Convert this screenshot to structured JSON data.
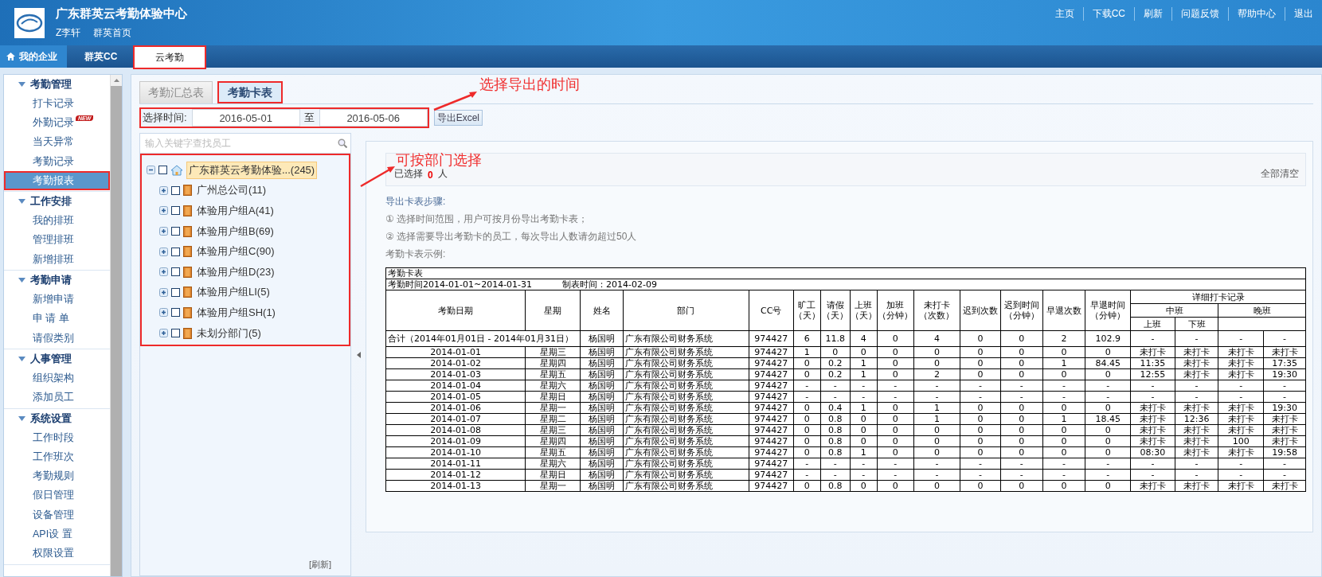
{
  "header": {
    "title": "广东群英云考勤体验中心",
    "user": "Z李轩",
    "home_link": "群英首页",
    "links": [
      "主页",
      "下载CC",
      "刷新",
      "问题反馈",
      "帮助中心",
      "退出"
    ]
  },
  "nav_tabs": [
    {
      "label": "我的企业",
      "kind": "home",
      "selected": false,
      "boxed": false
    },
    {
      "label": "群英CC",
      "kind": "tab",
      "selected": false,
      "boxed": false
    },
    {
      "label": "云考勤",
      "kind": "tab",
      "selected": true,
      "boxed": true
    }
  ],
  "sidebar": {
    "groups": [
      {
        "title": "考勤管理",
        "expanded": true,
        "items": [
          {
            "label": "打卡记录",
            "selected": false,
            "boxed": false
          },
          {
            "label": "外勤记录",
            "badge": "NEW",
            "selected": false,
            "boxed": false
          },
          {
            "label": "当天异常",
            "selected": false,
            "boxed": false
          },
          {
            "label": "考勤记录",
            "selected": false,
            "boxed": false
          },
          {
            "label": "考勤报表",
            "selected": true,
            "boxed": true
          }
        ]
      },
      {
        "title": "工作安排",
        "expanded": true,
        "items": [
          {
            "label": "我的排班",
            "selected": false,
            "boxed": false
          },
          {
            "label": "管理排班",
            "selected": false,
            "boxed": false
          },
          {
            "label": "新增排班",
            "selected": false,
            "boxed": false
          }
        ]
      },
      {
        "title": "考勤申请",
        "expanded": true,
        "items": [
          {
            "label": "新增申请",
            "selected": false,
            "boxed": false
          },
          {
            "label": "申 请 单",
            "selected": false,
            "boxed": false
          },
          {
            "label": "请假类别",
            "selected": false,
            "boxed": false
          }
        ]
      },
      {
        "title": "人事管理",
        "expanded": true,
        "items": [
          {
            "label": "组织架构",
            "selected": false,
            "boxed": false
          },
          {
            "label": "添加员工",
            "selected": false,
            "boxed": false
          }
        ]
      },
      {
        "title": "系统设置",
        "expanded": true,
        "items": [
          {
            "label": "工作时段",
            "selected": false,
            "boxed": false
          },
          {
            "label": "工作班次",
            "selected": false,
            "boxed": false
          },
          {
            "label": "考勤规则",
            "selected": false,
            "boxed": false
          },
          {
            "label": "假日管理",
            "selected": false,
            "boxed": false
          },
          {
            "label": "设备管理",
            "selected": false,
            "boxed": false
          },
          {
            "label": "API设 置",
            "selected": false,
            "boxed": false
          },
          {
            "label": "权限设置",
            "selected": false,
            "boxed": false
          }
        ]
      }
    ]
  },
  "report_tabs": [
    {
      "label": "考勤汇总表",
      "selected": false,
      "boxed": false
    },
    {
      "label": "考勤卡表",
      "selected": true,
      "boxed": true
    }
  ],
  "date_range": {
    "label": "选择时间:",
    "start": "2016-05-01",
    "separator": "至",
    "end": "2016-05-06",
    "boxed": true,
    "export_button": "导出Excel"
  },
  "tree": {
    "search_placeholder": "输入关键字查找员工",
    "boxed": true,
    "refresh": "[刷新]",
    "nodes": [
      {
        "label": "广东群英云考勤体验...(245)",
        "kind": "company",
        "expanded": true,
        "checked": false,
        "selected": true,
        "children": [
          {
            "label": "广州总公司(11)",
            "kind": "department",
            "expanded": false,
            "checked": false,
            "selected": false
          },
          {
            "label": "体验用户组A(41)",
            "kind": "department",
            "expanded": false,
            "checked": false,
            "selected": false
          },
          {
            "label": "体验用户组B(69)",
            "kind": "department",
            "expanded": false,
            "checked": false,
            "selected": false
          },
          {
            "label": "体验用户组C(90)",
            "kind": "department",
            "expanded": false,
            "checked": false,
            "selected": false
          },
          {
            "label": "体验用户组D(23)",
            "kind": "department",
            "expanded": false,
            "checked": false,
            "selected": false
          },
          {
            "label": "体验用户组LI(5)",
            "kind": "department",
            "expanded": false,
            "checked": false,
            "selected": false
          },
          {
            "label": "体验用户组SH(1)",
            "kind": "department",
            "expanded": false,
            "checked": false,
            "selected": false
          },
          {
            "label": "未划分部门(5)",
            "kind": "department",
            "expanded": false,
            "checked": false,
            "selected": false
          }
        ]
      }
    ]
  },
  "selection": {
    "label": "已选择",
    "count": "0",
    "unit": "人",
    "clear": "全部清空"
  },
  "steps": {
    "title": "导出卡表步骤:",
    "items": [
      "① 选择时间范围，用户可按月份导出考勤卡表；",
      "② 选择需要导出考勤卡的员工，每次导出人数请勿超过50人"
    ],
    "example_label": "考勤卡表示例:"
  },
  "card_table": {
    "title": "考勤卡表",
    "period": "考勤时间2014-01-01~2014-01-31",
    "made": "制表时间：2014-02-09",
    "columns": [
      {
        "title": "考勤日期"
      },
      {
        "title": "星期"
      },
      {
        "title": "姓名"
      },
      {
        "title": "部门"
      },
      {
        "title": "CC号"
      },
      {
        "title": "旷工",
        "unit": "（天）"
      },
      {
        "title": "请假",
        "unit": "（天）"
      },
      {
        "title": "上班",
        "unit": "（天）"
      },
      {
        "title": "加班",
        "unit": "（分钟）"
      },
      {
        "title": "未打卡",
        "unit": "（次数）"
      },
      {
        "title": "迟到次数"
      },
      {
        "title": "迟到时间",
        "unit": "（分钟）"
      },
      {
        "title": "早退次数"
      },
      {
        "title": "早退时间",
        "unit": "（分钟）"
      }
    ],
    "detail_header": "详细打卡记录",
    "shifts": [
      {
        "name": "中班",
        "subcolumns": [
          "上班",
          "下班"
        ]
      },
      {
        "name": "晚班"
      }
    ],
    "total": {
      "label": "合计（2014年01月01日 - 2014年01月31日）",
      "cells": [
        "杨国明",
        "广东有限公司财务系统",
        "974427",
        "6",
        "11.8",
        "4",
        "0",
        "4",
        "0",
        "0",
        "2",
        "102.9",
        "-",
        "-",
        "-",
        "-"
      ]
    },
    "rows": [
      [
        "2014-01-01",
        "星期三",
        "杨国明",
        "广东有限公司财务系统",
        "974427",
        "1",
        "0",
        "0",
        "0",
        "0",
        "0",
        "0",
        "0",
        "0",
        "未打卡",
        "未打卡",
        "未打卡",
        "未打卡"
      ],
      [
        "2014-01-02",
        "星期四",
        "杨国明",
        "广东有限公司财务系统",
        "974427",
        "0",
        "0.2",
        "1",
        "0",
        "0",
        "0",
        "0",
        "1",
        "84.45",
        "11:35",
        "未打卡",
        "未打卡",
        "17:35"
      ],
      [
        "2014-01-03",
        "星期五",
        "杨国明",
        "广东有限公司财务系统",
        "974427",
        "0",
        "0.2",
        "1",
        "0",
        "2",
        "0",
        "0",
        "0",
        "0",
        "12:55",
        "未打卡",
        "未打卡",
        "19:30"
      ],
      [
        "2014-01-04",
        "星期六",
        "杨国明",
        "广东有限公司财务系统",
        "974427",
        "-",
        "-",
        "-",
        "-",
        "-",
        "-",
        "-",
        "-",
        "-",
        "-",
        "-",
        "-",
        "-"
      ],
      [
        "2014-01-05",
        "星期日",
        "杨国明",
        "广东有限公司财务系统",
        "974427",
        "-",
        "-",
        "-",
        "-",
        "-",
        "-",
        "-",
        "-",
        "-",
        "-",
        "-",
        "-",
        "-"
      ],
      [
        "2014-01-06",
        "星期一",
        "杨国明",
        "广东有限公司财务系统",
        "974427",
        "0",
        "0.4",
        "1",
        "0",
        "1",
        "0",
        "0",
        "0",
        "0",
        "未打卡",
        "未打卡",
        "未打卡",
        "19:30"
      ],
      [
        "2014-01-07",
        "星期二",
        "杨国明",
        "广东有限公司财务系统",
        "974427",
        "0",
        "0.8",
        "0",
        "0",
        "1",
        "0",
        "0",
        "1",
        "18.45",
        "未打卡",
        "12:36",
        "未打卡",
        "未打卡"
      ],
      [
        "2014-01-08",
        "星期三",
        "杨国明",
        "广东有限公司财务系统",
        "974427",
        "0",
        "0.8",
        "0",
        "0",
        "0",
        "0",
        "0",
        "0",
        "0",
        "未打卡",
        "未打卡",
        "未打卡",
        "未打卡"
      ],
      [
        "2014-01-09",
        "星期四",
        "杨国明",
        "广东有限公司财务系统",
        "974427",
        "0",
        "0.8",
        "0",
        "0",
        "0",
        "0",
        "0",
        "0",
        "0",
        "未打卡",
        "未打卡",
        "100",
        "未打卡"
      ],
      [
        "2014-01-10",
        "星期五",
        "杨国明",
        "广东有限公司财务系统",
        "974427",
        "0",
        "0.8",
        "1",
        "0",
        "0",
        "0",
        "0",
        "0",
        "0",
        "08:30",
        "未打卡",
        "未打卡",
        "19:58"
      ],
      [
        "2014-01-11",
        "星期六",
        "杨国明",
        "广东有限公司财务系统",
        "974427",
        "-",
        "-",
        "-",
        "-",
        "-",
        "-",
        "-",
        "-",
        "-",
        "-",
        "-",
        "-",
        "-"
      ],
      [
        "2014-01-12",
        "星期日",
        "杨国明",
        "广东有限公司财务系统",
        "974427",
        "-",
        "-",
        "-",
        "-",
        "-",
        "-",
        "-",
        "-",
        "-",
        "-",
        "-",
        "-",
        "-"
      ],
      [
        "2014-01-13",
        "星期一",
        "杨国明",
        "广东有限公司财务系统",
        "974427",
        "0",
        "0.8",
        "0",
        "0",
        "0",
        "0",
        "0",
        "0",
        "0",
        "未打卡",
        "未打卡",
        "未打卡",
        "未打卡"
      ]
    ]
  },
  "annotations": [
    {
      "text": "选择导出的时间"
    },
    {
      "text": "可按部门选择"
    }
  ]
}
